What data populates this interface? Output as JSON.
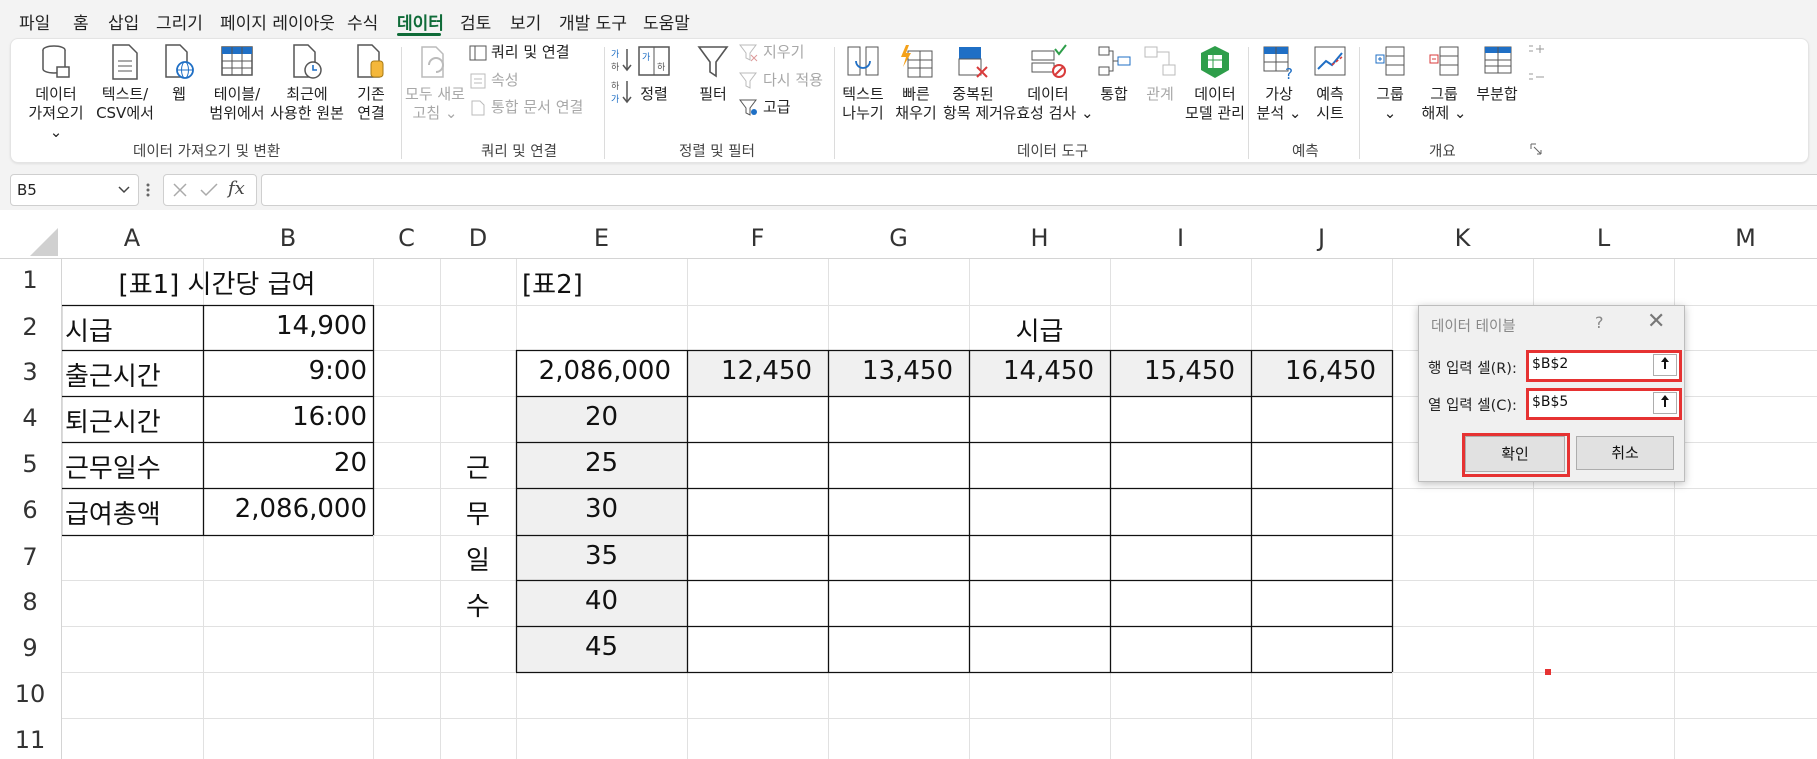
{
  "menu": {
    "items": [
      "파일",
      "홈",
      "삽입",
      "그리기",
      "페이지 레이아웃",
      "수식",
      "데이터",
      "검토",
      "보기",
      "개발 도구",
      "도움말"
    ],
    "active": "데이터"
  },
  "ribbon": {
    "get_data": {
      "line1": "데이터",
      "line2": "가져오기 ⌄"
    },
    "text_csv": {
      "line1": "텍스트/",
      "line2": "CSV에서"
    },
    "web": {
      "line1": "웹"
    },
    "table_range": {
      "line1": "테이블/",
      "line2": "범위에서"
    },
    "recent_sources": {
      "line1": "최근에",
      "line2": "사용한 원본"
    },
    "existing_conn": {
      "line1": "기존",
      "line2": "연결"
    },
    "group_get_transform": "데이터 가져오기 및 변환",
    "refresh_all": {
      "line1": "모두 새로",
      "line2": "고침 ⌄"
    },
    "queries_connections": "쿼리 및 연결",
    "properties": "속성",
    "edit_links": "통합 문서 연결",
    "group_queries": "쿼리 및 연결",
    "sort_asc": "↓",
    "sort": "정렬",
    "filter": "필터",
    "clear": "지우기",
    "reapply": "다시 적용",
    "advanced": "고급",
    "group_sort_filter": "정렬 및 필터",
    "text_to_columns": {
      "line1": "텍스트",
      "line2": "나누기"
    },
    "flash_fill": {
      "line1": "빠른",
      "line2": "채우기"
    },
    "remove_dup": {
      "line1": "중복된",
      "line2": "항목 제거"
    },
    "validation": {
      "line1": "데이터",
      "line2": "유효성 검사 ⌄"
    },
    "consolidate": "통합",
    "relationships": "관계",
    "data_model": {
      "line1": "데이터",
      "line2": "모델 관리"
    },
    "group_data_tools": "데이터 도구",
    "whatif": {
      "line1": "가상",
      "line2": "분석 ⌄"
    },
    "forecast_sheet": {
      "line1": "예측",
      "line2": "시트"
    },
    "group_forecast": "예측",
    "group_btn": {
      "line1": "그룹",
      "line2": "⌄"
    },
    "ungroup": {
      "line1": "그룹",
      "line2": "해제 ⌄"
    },
    "subtotal": "부분합",
    "group_outline": "개요"
  },
  "formula_bar": {
    "name_box": "B5",
    "formula": ""
  },
  "columns": [
    "A",
    "B",
    "C",
    "D",
    "E",
    "F",
    "G",
    "H",
    "I",
    "J",
    "K",
    "L",
    "M"
  ],
  "rows": [
    "1",
    "2",
    "3",
    "4",
    "5",
    "6",
    "7",
    "8",
    "9",
    "10",
    "11"
  ],
  "table1": {
    "title": "[표1]  시간당 급여",
    "rows": [
      {
        "label": "시급",
        "value": "14,900"
      },
      {
        "label": "출근시간",
        "value": "9:00"
      },
      {
        "label": "퇴근시간",
        "value": "16:00"
      },
      {
        "label": "근무일수",
        "value": "20"
      },
      {
        "label": "급여총액",
        "value": "2,086,000"
      }
    ]
  },
  "table2": {
    "title": "[표2]",
    "header": "시급",
    "corner": "2,086,000",
    "wages": [
      "12,450",
      "13,450",
      "14,450",
      "15,450",
      "16,450"
    ],
    "days_label": [
      "근",
      "무",
      "일",
      "수"
    ],
    "days": [
      "20",
      "25",
      "30",
      "35",
      "40",
      "45"
    ]
  },
  "dialog": {
    "title": "데이터 테이블",
    "help": "?",
    "close": "✕",
    "row_label": "행 입력 셀(R):",
    "row_value": "$B$2",
    "col_label": "열 입력 셀(C):",
    "col_value": "$B$5",
    "ok": "확인",
    "cancel": "취소"
  }
}
